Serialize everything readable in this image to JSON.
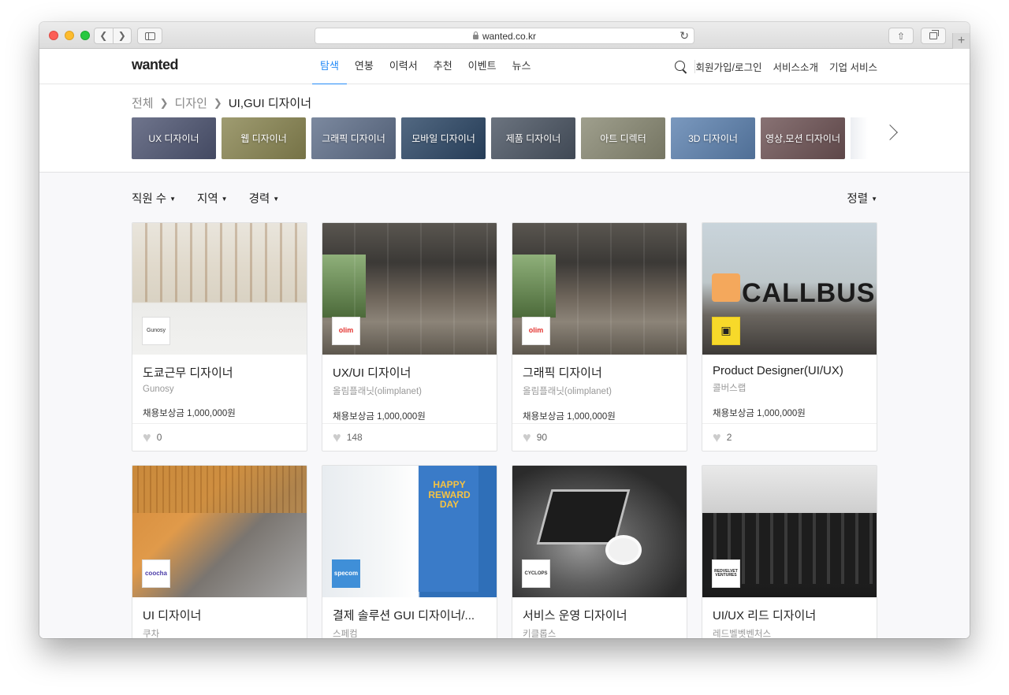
{
  "browser": {
    "url": "wanted.co.kr"
  },
  "header": {
    "logo": "wanted",
    "nav": [
      "탐색",
      "연봉",
      "이력서",
      "추천",
      "이벤트",
      "뉴스"
    ],
    "links": [
      "회원가입/로그인",
      "서비스소개",
      "기업 서비스"
    ]
  },
  "breadcrumb": {
    "items": [
      "전체",
      "디자인"
    ],
    "current": "UI,GUI 디자이너"
  },
  "categories": [
    {
      "label": "UX 디자이너",
      "color": "#4f5673"
    },
    {
      "label": "웹 디자이너",
      "color": "#8a8652"
    },
    {
      "label": "그래픽 디자이너",
      "color": "#5f6f8a"
    },
    {
      "label": "모바일 디자이너",
      "color": "#2c4766"
    },
    {
      "label": "제품 디자이너",
      "color": "#4b5563"
    },
    {
      "label": "아트 디렉터",
      "color": "#8a8a74"
    },
    {
      "label": "3D 디자이너",
      "color": "#5d82b0"
    },
    {
      "label": "영상,모션 디자이너",
      "color": "#6e5355"
    }
  ],
  "filters": [
    "직원 수",
    "지역",
    "경력"
  ],
  "sort_label": "정렬",
  "jobs": [
    {
      "title": "도쿄근무 디자이너",
      "company": "Gunosy",
      "reward": "채용보상금 1,000,000원",
      "likes": "0",
      "logo": "Gunosy"
    },
    {
      "title": "UX/UI 디자이너",
      "company": "올림플래닛(olimplanet)",
      "reward": "채용보상금 1,000,000원",
      "likes": "148",
      "logo": "olim"
    },
    {
      "title": "그래픽 디자이너",
      "company": "올림플래닛(olimplanet)",
      "reward": "채용보상금 1,000,000원",
      "likes": "90",
      "logo": "olim"
    },
    {
      "title": "Product Designer(UI/UX)",
      "company": "콜버스랩",
      "reward": "채용보상금 1,000,000원",
      "likes": "2",
      "logo": ""
    },
    {
      "title": "UI 디자이너",
      "company": "쿠차",
      "reward": "",
      "likes": "",
      "logo": "coocha"
    },
    {
      "title": "결제 솔루션 GUI 디자이너/...",
      "company": "스페컴",
      "reward": "",
      "likes": "",
      "logo": "specom"
    },
    {
      "title": "서비스 운영 디자이너",
      "company": "키클롭스",
      "reward": "",
      "likes": "",
      "logo": "CYCLOPS"
    },
    {
      "title": "UI/UX 리드 디자이너",
      "company": "레드벨벳벤처스",
      "reward": "",
      "likes": "",
      "logo": "REDVELVET VENTURES"
    }
  ],
  "image_text": {
    "callbus": "CALLBUS",
    "specom_banner": "HAPPY REWARD DAY"
  },
  "colors": {
    "accent": "#258bf7"
  }
}
